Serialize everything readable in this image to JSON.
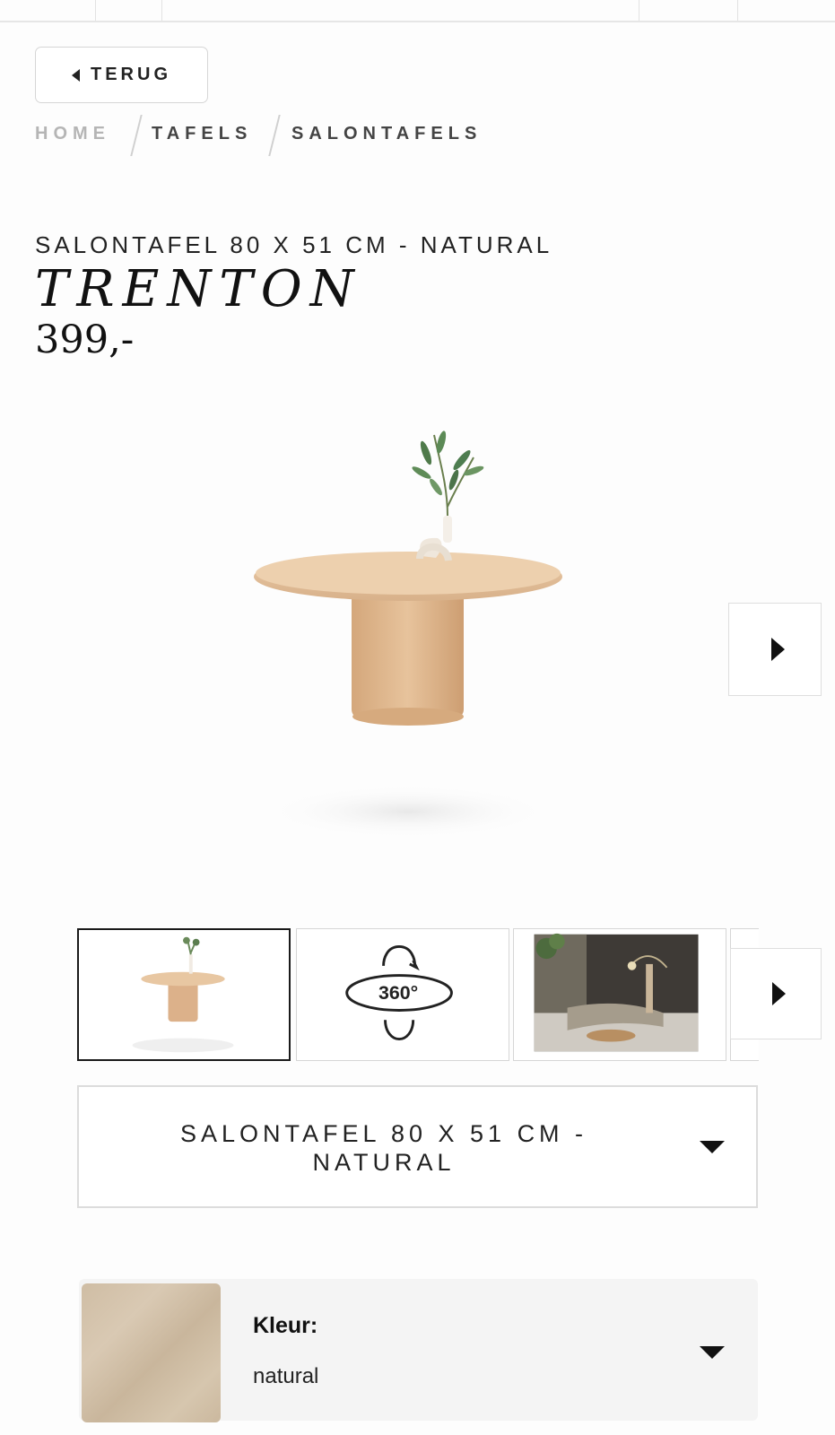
{
  "nav": {
    "back_label": "TERUG",
    "breadcrumb": [
      {
        "label": "HOME",
        "color": "#b5b5b5"
      },
      {
        "label": "TAFELS",
        "color": "#444444"
      },
      {
        "label": "SALONTAFELS",
        "color": "#444444"
      }
    ]
  },
  "product": {
    "subtitle": "SALONTAFEL 80 X 51 CM - NATURAL",
    "name": "TRENTON",
    "price": "399,-"
  },
  "gallery": {
    "thumbnails": [
      {
        "type": "product-image",
        "active": true
      },
      {
        "type": "360-view",
        "label": "360°"
      },
      {
        "type": "room-scene"
      }
    ]
  },
  "variant": {
    "selected_label": "SALONTAFEL 80 X 51 CM - NATURAL"
  },
  "color": {
    "label": "Kleur:",
    "value": "natural",
    "swatch_color": "#d2c1a8"
  }
}
